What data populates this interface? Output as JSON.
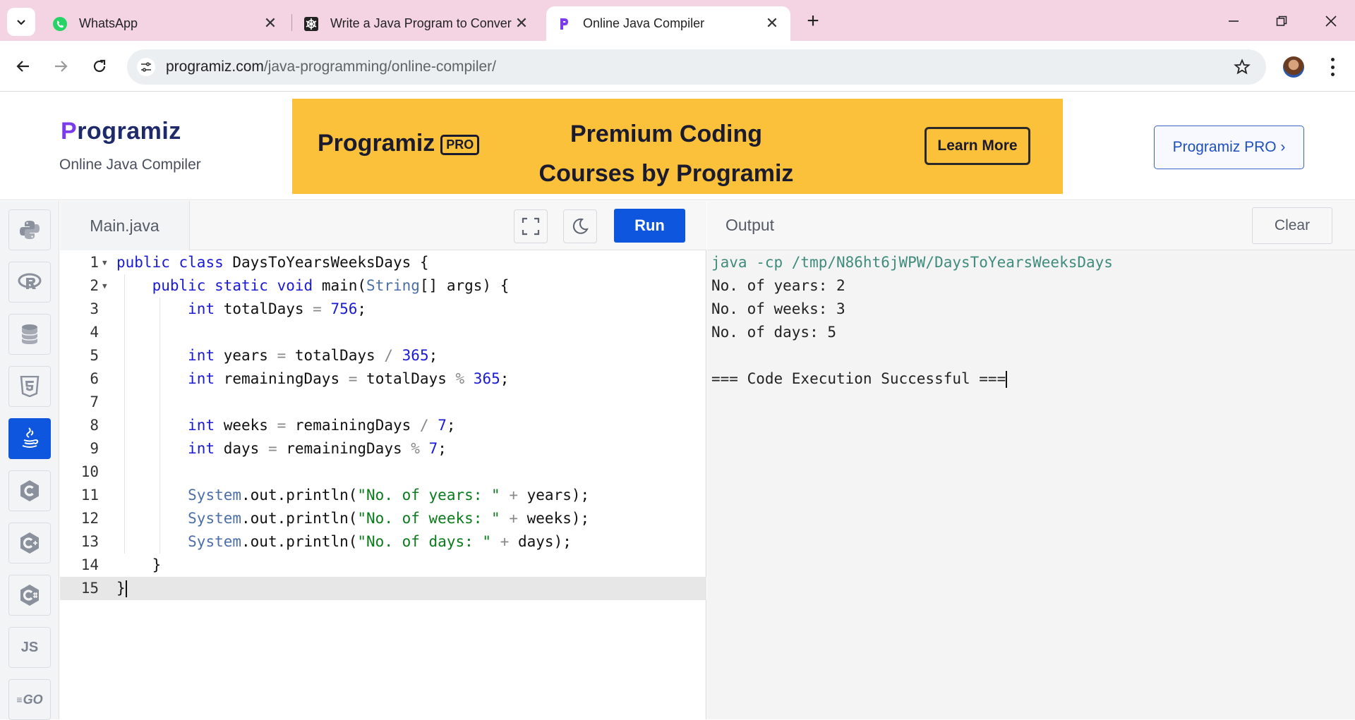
{
  "browser": {
    "tabs": [
      {
        "title": "WhatsApp",
        "icon": "whatsapp-icon",
        "active": false
      },
      {
        "title": "Write a Java Program to Conver",
        "icon": "chatgpt-icon",
        "active": false
      },
      {
        "title": "Online Java Compiler",
        "icon": "programiz-icon",
        "active": true
      }
    ],
    "url_host": "programiz.com",
    "url_path": "/java-programming/online-compiler/"
  },
  "header": {
    "logo_mark": "P",
    "logo_rest": "rogramiz",
    "subtitle": "Online Java Compiler",
    "banner": {
      "logo": "Programiz",
      "logo_badge": "PRO",
      "title_line1": "Premium Coding",
      "title_line2": "Courses by Programiz",
      "button": "Learn More",
      "color": "#fbc13b"
    },
    "pro_button": "Programiz PRO ›"
  },
  "sidebar": {
    "languages": [
      {
        "name": "python",
        "label": ""
      },
      {
        "name": "r",
        "label": "R"
      },
      {
        "name": "sql",
        "label": ""
      },
      {
        "name": "html",
        "label": "5"
      },
      {
        "name": "java",
        "label": "",
        "active": true
      },
      {
        "name": "c",
        "label": "C"
      },
      {
        "name": "cpp",
        "label": "C"
      },
      {
        "name": "csharp",
        "label": "C"
      },
      {
        "name": "js",
        "label": "JS"
      },
      {
        "name": "go",
        "label": "GO"
      }
    ],
    "active_color": "#0f56df"
  },
  "editor": {
    "filename": "Main.java",
    "run_label": "Run",
    "lines": [
      "public class DaysToYearsWeeksDays {",
      "    public static void main(String[] args) {",
      "        int totalDays = 756;",
      "",
      "        int years = totalDays / 365;",
      "        int remainingDays = totalDays % 365;",
      "",
      "        int weeks = remainingDays / 7;",
      "        int days = remainingDays % 7;",
      "",
      "        System.out.println(\"No. of years: \" + years);",
      "        System.out.println(\"No. of weeks: \" + weeks);",
      "        System.out.println(\"No. of days: \" + days);",
      "    }",
      "}"
    ],
    "current_line": 15
  },
  "output": {
    "title": "Output",
    "clear_label": "Clear",
    "lines": [
      "java -cp /tmp/N86ht6jWPW/DaysToYearsWeeksDays",
      "No. of years: 2",
      "No. of weeks: 3",
      "No. of days: 5",
      "",
      "=== Code Execution Successful ==="
    ]
  }
}
